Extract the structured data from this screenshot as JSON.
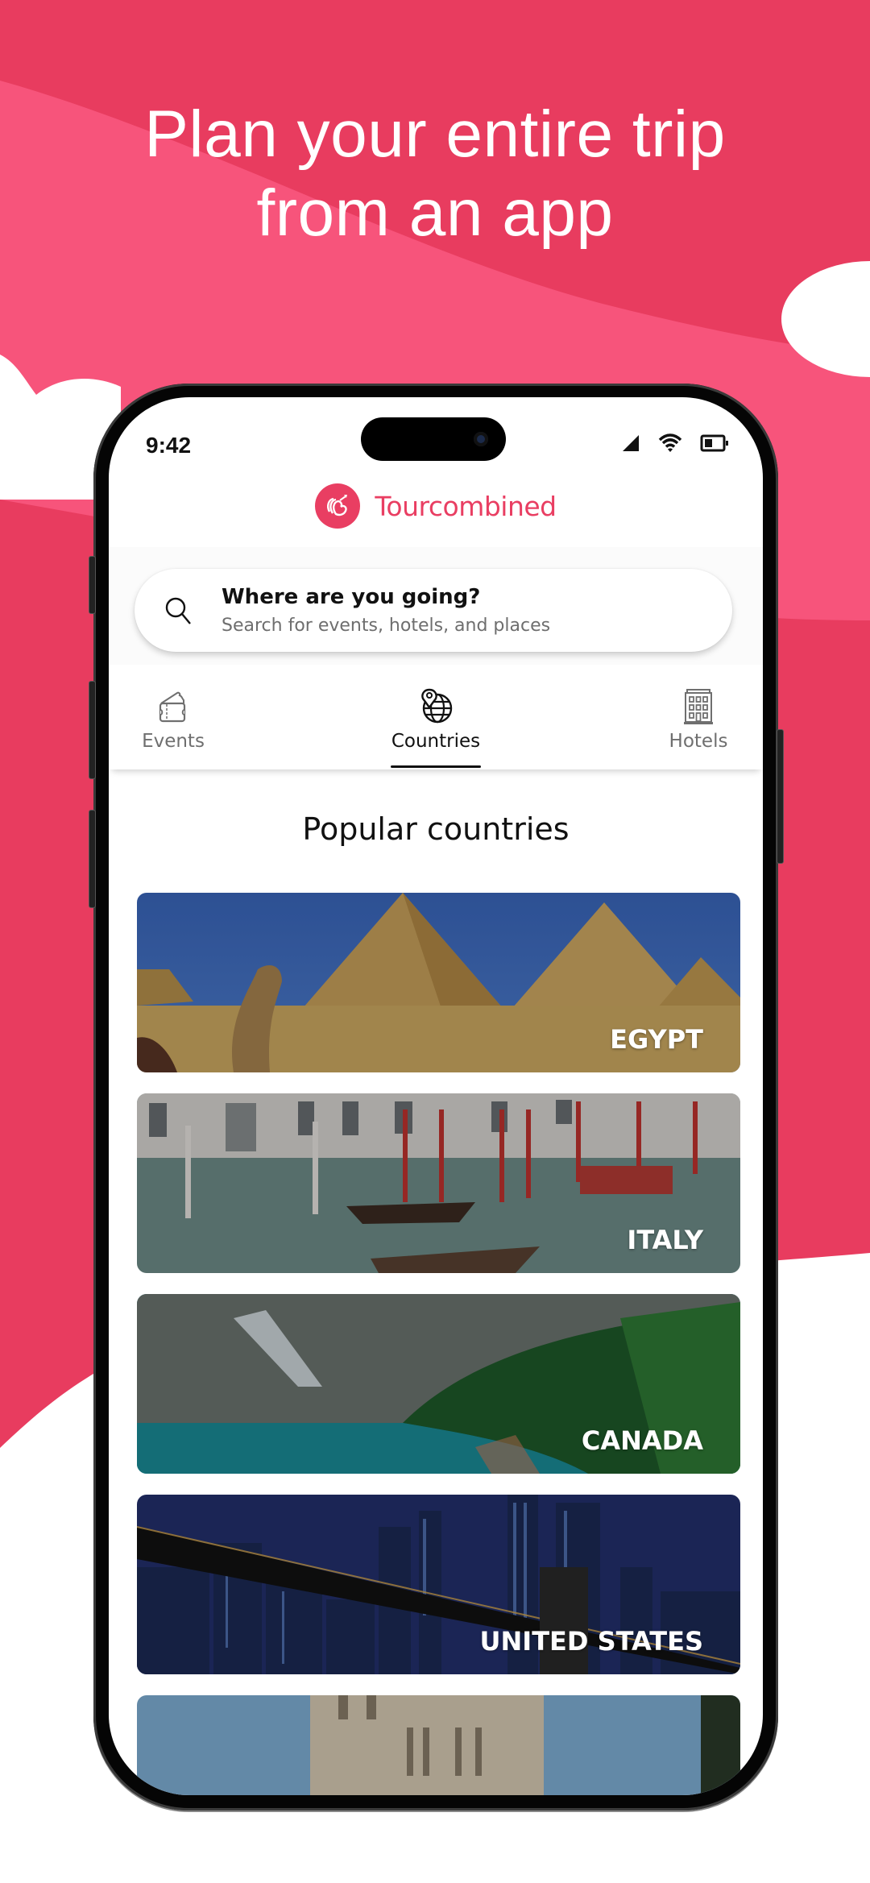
{
  "promo": {
    "headline_line1": "Plan your entire trip",
    "headline_line2": "from an app",
    "colors": {
      "pink_dark": "#E83C5F",
      "pink_light": "#F7547B",
      "white": "#FFFFFF"
    }
  },
  "status_bar": {
    "time": "9:42",
    "icons": [
      "cellular-signal-icon",
      "wifi-icon",
      "battery-icon"
    ]
  },
  "app": {
    "name": "Tourcombined",
    "logo_icon": "tourcombined-logo-icon",
    "brand_color": "#E93E62"
  },
  "search": {
    "icon": "search-icon",
    "title": "Where are you going?",
    "placeholder": "Search for events, hotels, and places"
  },
  "tabs": [
    {
      "label": "Events",
      "icon": "ticket-icon",
      "active": false
    },
    {
      "label": "Countries",
      "icon": "globe-pin-icon",
      "active": true
    },
    {
      "label": "Hotels",
      "icon": "hotel-building-icon",
      "active": false
    }
  ],
  "main": {
    "section_title": "Popular countries",
    "countries": [
      {
        "name": "EGYPT"
      },
      {
        "name": "ITALY"
      },
      {
        "name": "CANADA"
      },
      {
        "name": "UNITED STATES"
      },
      {
        "name": ""
      }
    ]
  }
}
